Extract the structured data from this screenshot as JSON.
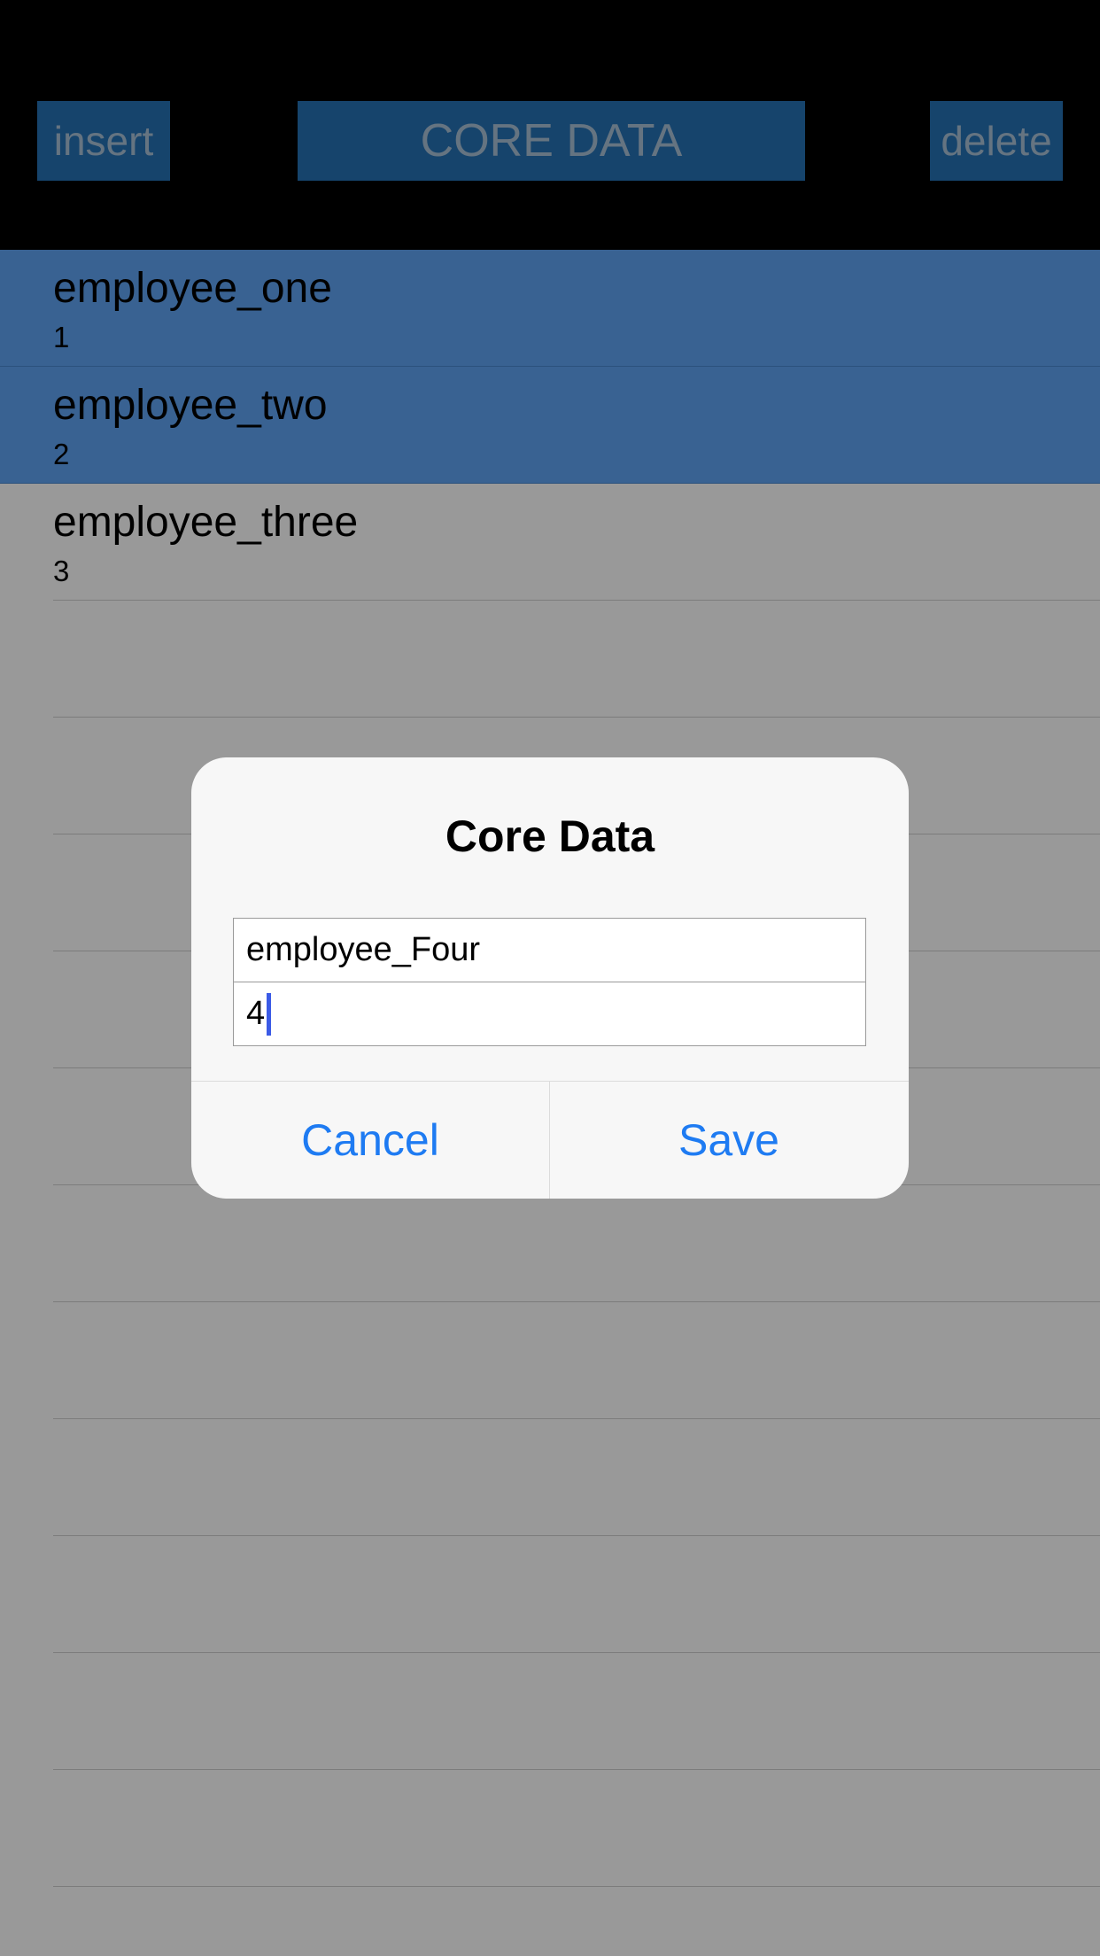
{
  "nav": {
    "insert_label": "insert",
    "title": "CORE DATA",
    "delete_label": "delete"
  },
  "list": {
    "rows": [
      {
        "title": "employee_one",
        "subtitle": "1",
        "selected": true
      },
      {
        "title": "employee_two",
        "subtitle": "2",
        "selected": true
      },
      {
        "title": "employee_three",
        "subtitle": "3",
        "selected": false
      }
    ],
    "empty_row_count": 12
  },
  "alert": {
    "title": "Core Data",
    "name_field_value": "employee_Four",
    "id_field_value": "4",
    "cancel_label": "Cancel",
    "save_label": "Save"
  },
  "colors": {
    "nav_button_bg": "#2672b5",
    "nav_button_text": "#a9c2d8",
    "selected_row_bg": "#5fa3f4",
    "alert_button_text": "#1e7bf2",
    "caret": "#3b5be6"
  }
}
